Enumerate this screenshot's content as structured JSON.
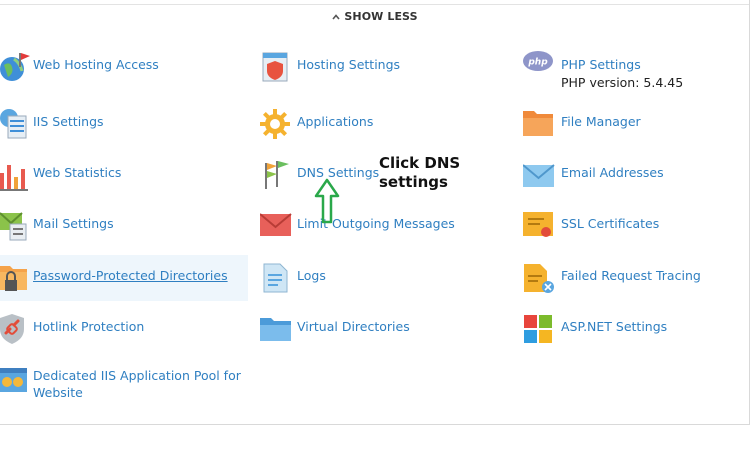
{
  "header": {
    "toggle_label": "SHOW LESS"
  },
  "items": [
    {
      "label": "Web Hosting Access",
      "icon": "globe-flag-icon"
    },
    {
      "label": "IIS Settings",
      "icon": "server-settings-icon"
    },
    {
      "label": "Web Statistics",
      "icon": "bar-chart-icon"
    },
    {
      "label": "Mail Settings",
      "icon": "mail-settings-icon"
    },
    {
      "label": "Password-Protected Directories",
      "icon": "locked-folder-icon"
    },
    {
      "label": "Hotlink Protection",
      "icon": "shield-link-icon"
    },
    {
      "label": "Dedicated IIS Application Pool for",
      "label2": "Website",
      "icon": "app-pool-icon"
    },
    {
      "label": "Hosting Settings",
      "icon": "document-shield-icon"
    },
    {
      "label": "Applications",
      "icon": "gear-icon"
    },
    {
      "label": "DNS Settings",
      "icon": "dns-flags-icon"
    },
    {
      "label": "Limit Outgoing Messages",
      "icon": "envelope-limit-icon"
    },
    {
      "label": "Logs",
      "icon": "log-file-icon"
    },
    {
      "label": "Virtual Directories",
      "icon": "folder-icon"
    },
    {
      "label": "PHP Settings",
      "sub": "PHP version: 5.4.45",
      "icon": "php-icon"
    },
    {
      "label": "File Manager",
      "icon": "orange-folder-icon"
    },
    {
      "label": "Email Addresses",
      "icon": "envelope-icon"
    },
    {
      "label": "SSL Certificates",
      "icon": "certificate-icon"
    },
    {
      "label": "Failed Request Tracing",
      "icon": "trace-document-icon"
    },
    {
      "label": "ASP.NET Settings",
      "icon": "windows-tiles-icon"
    }
  ],
  "annotation": {
    "line1": "Click DNS",
    "line2": "settings"
  },
  "colors": {
    "link": "#2f7fc1",
    "highlight": "#eef6fc",
    "arrow": "#2aa84a"
  }
}
